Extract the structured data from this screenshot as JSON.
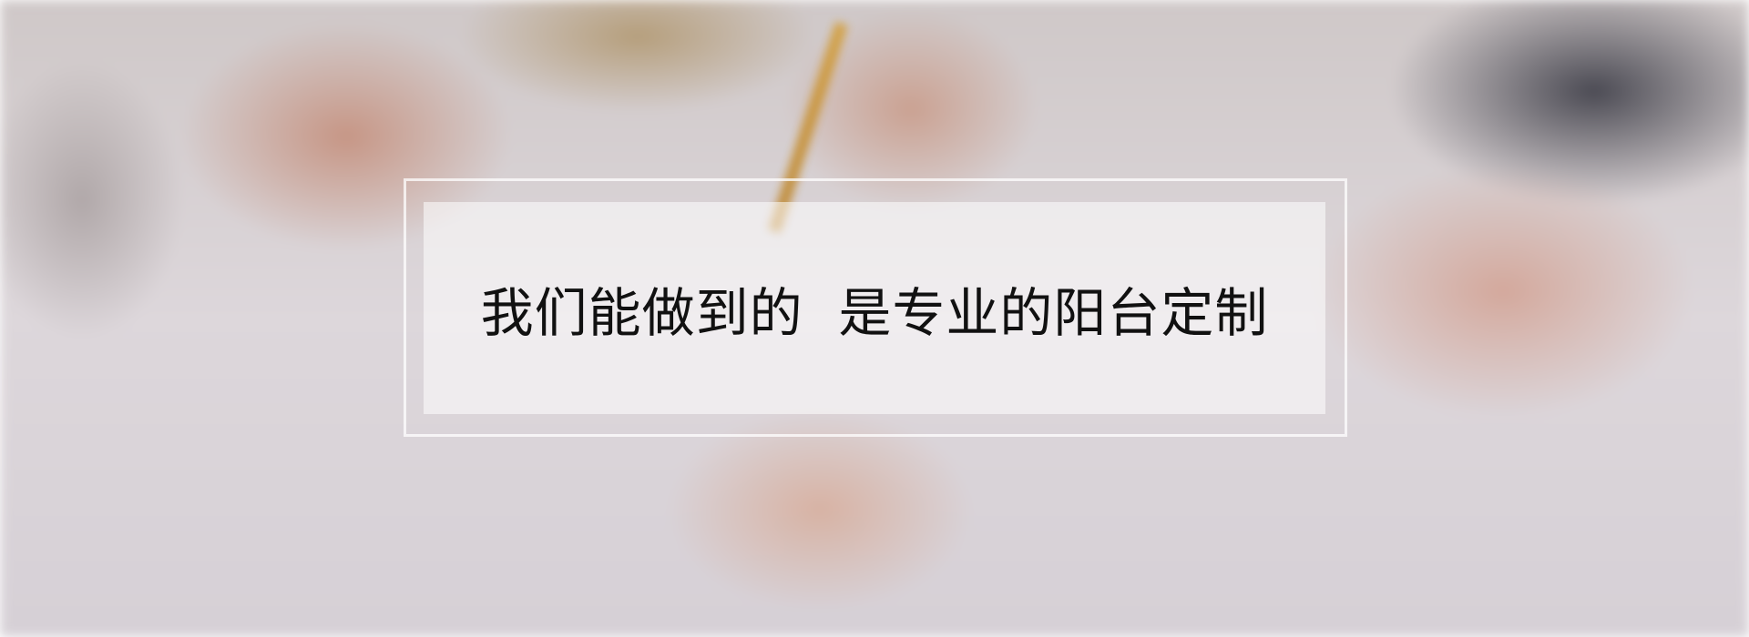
{
  "banner": {
    "slogan": "我们能做到的  是专业的阳台定制"
  }
}
